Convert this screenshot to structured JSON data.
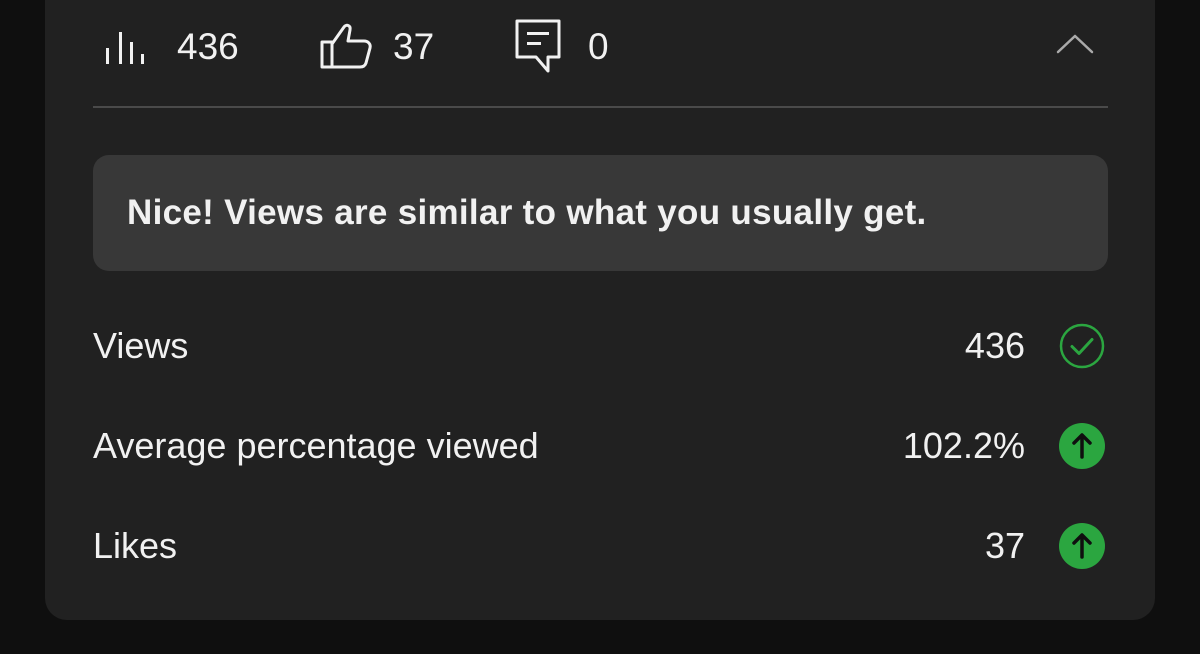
{
  "stats_bar": {
    "views": {
      "icon": "bar-chart-icon",
      "value": "436"
    },
    "likes": {
      "icon": "thumbs-up-icon",
      "value": "37"
    },
    "comments": {
      "icon": "comment-icon",
      "value": "0"
    },
    "collapse_icon": "chevron-up-icon"
  },
  "notice": {
    "text": "Nice! Views are similar to what you usually get."
  },
  "metrics": [
    {
      "label": "Views",
      "value": "436",
      "status": "check-circle-icon"
    },
    {
      "label": "Average percentage viewed",
      "value": "102.2%",
      "status": "arrow-up-icon"
    },
    {
      "label": "Likes",
      "value": "37",
      "status": "arrow-up-icon"
    }
  ],
  "colors": {
    "background": "#0f0f0f",
    "card": "#212121",
    "notice": "#383838",
    "positive_green": "#2ba640",
    "text": "#f1f1f1"
  }
}
